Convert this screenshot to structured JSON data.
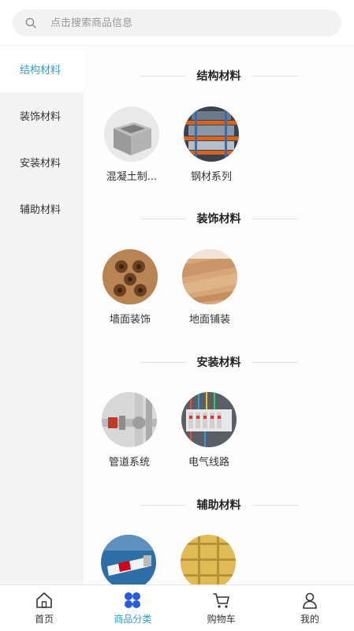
{
  "search": {
    "placeholder": "点击搜索商品信息"
  },
  "sidebar": {
    "items": [
      {
        "label": "结构材料",
        "active": true
      },
      {
        "label": "装饰材料",
        "active": false
      },
      {
        "label": "安装材料",
        "active": false
      },
      {
        "label": "辅助材料",
        "active": false
      }
    ]
  },
  "sections": [
    {
      "title": "结构材料",
      "products": [
        {
          "name": "混凝土制...",
          "image": "concrete-block"
        },
        {
          "name": "钢材系列",
          "image": "steel-shelves"
        }
      ]
    },
    {
      "title": "装饰材料",
      "products": [
        {
          "name": "墙面装饰",
          "image": "wood-wall-panel"
        },
        {
          "name": "地面铺装",
          "image": "wood-floor"
        }
      ]
    },
    {
      "title": "安装材料",
      "products": [
        {
          "name": "管道系统",
          "image": "pipes"
        },
        {
          "name": "电气线路",
          "image": "electrical-breakers"
        }
      ]
    },
    {
      "title": "辅助材料",
      "products": [
        {
          "name": "",
          "image": "sealant-tube"
        },
        {
          "name": "",
          "image": "insulation-board"
        }
      ]
    }
  ],
  "tabbar": {
    "items": [
      {
        "label": "首页",
        "icon": "home-icon",
        "active": false
      },
      {
        "label": "商品分类",
        "icon": "category-icon",
        "active": true
      },
      {
        "label": "购物车",
        "icon": "cart-icon",
        "active": false
      },
      {
        "label": "我的",
        "icon": "user-icon",
        "active": false
      }
    ]
  },
  "colors": {
    "accent": "#2a9fd8",
    "sidebar_bg": "#f4f4f4"
  }
}
